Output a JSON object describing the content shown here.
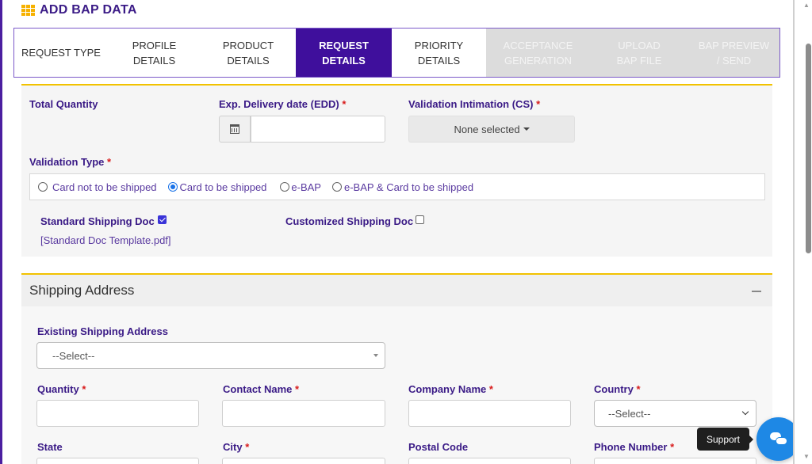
{
  "header": {
    "title": "ADD BAP DATA"
  },
  "tabs": [
    {
      "label": "REQUEST TYPE",
      "state": "normal"
    },
    {
      "label": "PROFILE DETAILS",
      "state": "normal"
    },
    {
      "label": "PRODUCT DETAILS",
      "state": "normal"
    },
    {
      "label": "REQUEST DETAILS",
      "state": "active"
    },
    {
      "label": "PRIORITY DETAILS",
      "state": "normal"
    },
    {
      "label": "ACCEPTANCE GENERATION",
      "state": "disabled"
    },
    {
      "label": "UPLOAD BAP FILE",
      "state": "disabled"
    },
    {
      "label": "BAP PREVIEW / SEND",
      "state": "disabled"
    }
  ],
  "request": {
    "total_quantity_label": "Total Quantity",
    "edd_label": "Exp. Delivery date (EDD)",
    "edd_value": "",
    "validation_intimation_label": "Validation Intimation (CS)",
    "validation_intimation_value": "None selected",
    "validation_type_label": "Validation Type",
    "required_mark": "*",
    "validation_options": [
      {
        "label": "Card not to be shipped",
        "checked": false
      },
      {
        "label": "Card to be shipped",
        "checked": true
      },
      {
        "label": "e-BAP",
        "checked": false
      },
      {
        "label": "e-BAP & Card to be shipped",
        "checked": false
      }
    ],
    "standard_doc_label": "Standard Shipping Doc",
    "standard_doc_checked": true,
    "custom_doc_label": "Customized Shipping Doc",
    "custom_doc_checked": false,
    "template_link": "[Standard Doc Template.pdf]"
  },
  "shipping": {
    "title": "Shipping Address",
    "existing_label": "Existing Shipping Address",
    "existing_value": "--Select--",
    "quantity_label": "Quantity",
    "contact_label": "Contact Name",
    "company_label": "Company Name",
    "country_label": "Country",
    "country_value": "--Select--",
    "state_label": "State",
    "city_label": "City",
    "postal_label": "Postal Code",
    "phone_label": "Phone Number"
  },
  "support": {
    "label": "Support"
  },
  "colors": {
    "accent": "#3f0f9c",
    "highlight": "#f2c200",
    "required": "#d81b1b",
    "chat": "#1e88e5"
  }
}
